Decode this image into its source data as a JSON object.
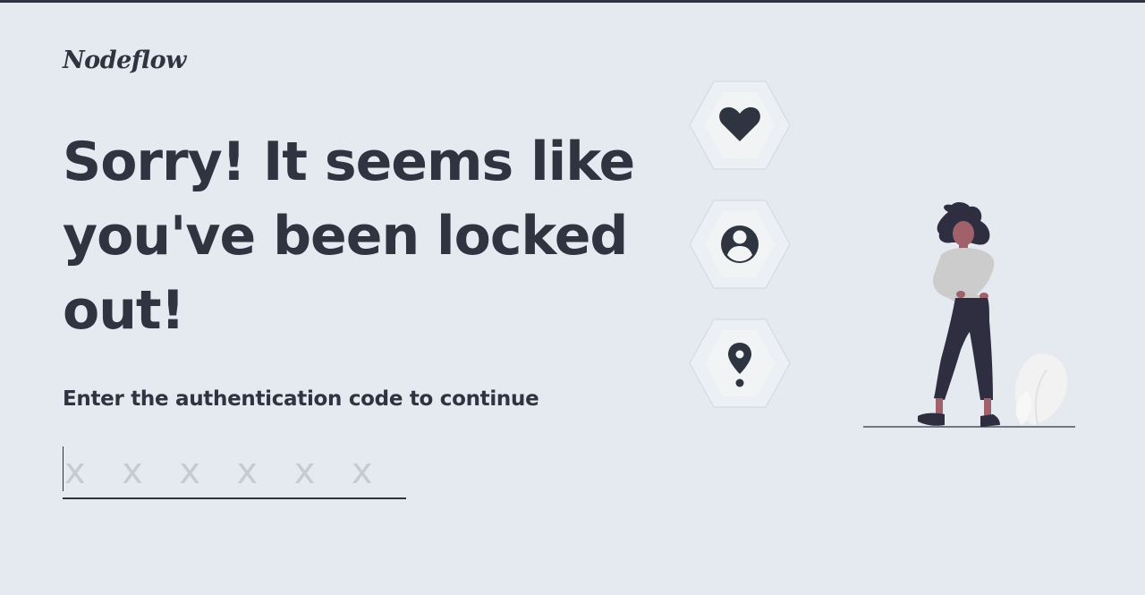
{
  "brand": {
    "name": "Nodeflow"
  },
  "headline": "Sorry! It seems like you've been locked out!",
  "subtitle": "Enter the authentication code to continue",
  "code_input": {
    "placeholder": "xxxxxx",
    "value": ""
  },
  "icons": [
    {
      "name": "heart-icon"
    },
    {
      "name": "user-icon"
    },
    {
      "name": "location-pin-icon"
    }
  ],
  "colors": {
    "background": "#e5e9f0",
    "text": "#2e3440",
    "placeholder": "#c6cad2",
    "hex_fill": "#eceff4",
    "hex_inner": "#f2f2f2",
    "accent_skin": "#a0616a",
    "figure_top": "#cccccc"
  }
}
